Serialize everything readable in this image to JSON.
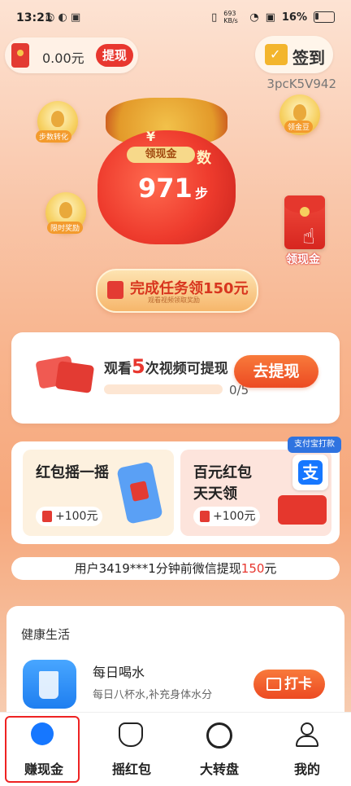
{
  "status_bar": {
    "time": "13:21",
    "net_speed": "693 KB/s",
    "battery": "16%"
  },
  "wallet": {
    "amount": "0.00元",
    "withdraw_label": "提现"
  },
  "checkin": {
    "label": "签到"
  },
  "user_code": "3pcK5V942",
  "coins": {
    "step_convert": "步数转化",
    "claim_gold": "领金豆",
    "limited_reward": "限时奖励"
  },
  "money_bag": {
    "tag": "领现金",
    "yen": "¥",
    "shu": "数",
    "steps": "971",
    "steps_unit": "步"
  },
  "side_packet": {
    "label": "领现金"
  },
  "task_banner": {
    "text": "完成任务领150元",
    "sub": "观看视频领取奖励"
  },
  "video_card": {
    "title_prefix": "观看",
    "title_num": "5",
    "title_suffix": "次视频可提现",
    "progress_text": "0/5",
    "progress_fraction": 0.0,
    "button_label": "去提现"
  },
  "cards": {
    "shake": {
      "title": "红包摇一摇",
      "reward": "+100元"
    },
    "hundred": {
      "title_line1": "百元红包",
      "title_line2": "天天领",
      "reward": "+100元"
    },
    "alipay_badge": "支付宝打款",
    "alipay_glyph": "支"
  },
  "ticker": {
    "prefix": "用户3419***1分钟前微信提现",
    "amount": "150",
    "suffix": "元"
  },
  "health": {
    "header": "健康生活",
    "item_name": "每日喝水",
    "item_desc": "每日八杯水,补充身体水分",
    "punch_label": "打卡"
  },
  "nav": {
    "items": [
      {
        "label": "赚现金",
        "icon": "running-person-icon"
      },
      {
        "label": "摇红包",
        "icon": "money-bag-icon"
      },
      {
        "label": "大转盘",
        "icon": "wheel-icon"
      },
      {
        "label": "我的",
        "icon": "user-icon"
      }
    ]
  }
}
